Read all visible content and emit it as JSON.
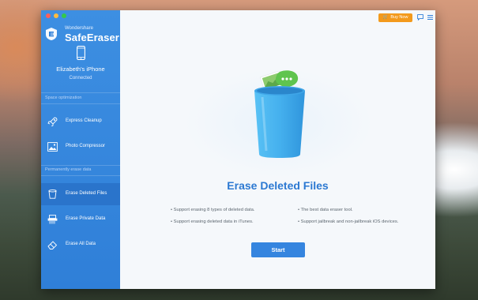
{
  "app": {
    "brand_small": "Wondershare",
    "brand_name": "SafeEraser"
  },
  "device": {
    "name": "Elizabeth's iPhone",
    "status": "Connected"
  },
  "sidebar": {
    "sections": [
      {
        "label": "Space optimization",
        "items": [
          {
            "label": "Express Cleanup",
            "icon": "rocket-icon"
          },
          {
            "label": "Photo Compressor",
            "icon": "photo-icon"
          }
        ]
      },
      {
        "label": "Permanently erase data",
        "items": [
          {
            "label": "Erase Deleted Files",
            "icon": "trash-icon",
            "active": true
          },
          {
            "label": "Erase Private Data",
            "icon": "shredder-icon"
          },
          {
            "label": "Erase All Data",
            "icon": "eraser-icon"
          }
        ]
      }
    ]
  },
  "header": {
    "buy_label": "Buy Now"
  },
  "main": {
    "title": "Erase Deleted Files",
    "features_left": [
      "• Support erasing 8 types of deleted data.",
      "• Support erasing deleted data in iTunes."
    ],
    "features_right": [
      "• The best data eraser tool.",
      "• Support jailbreak and non-jailbreak iOS devices."
    ],
    "start_label": "Start"
  },
  "colors": {
    "sidebar": "#3d8fe2",
    "sidebar_active": "#2a74cb",
    "accent": "#2c79d2",
    "buy_button": "#f39a1c",
    "start_button": "#3585df"
  }
}
